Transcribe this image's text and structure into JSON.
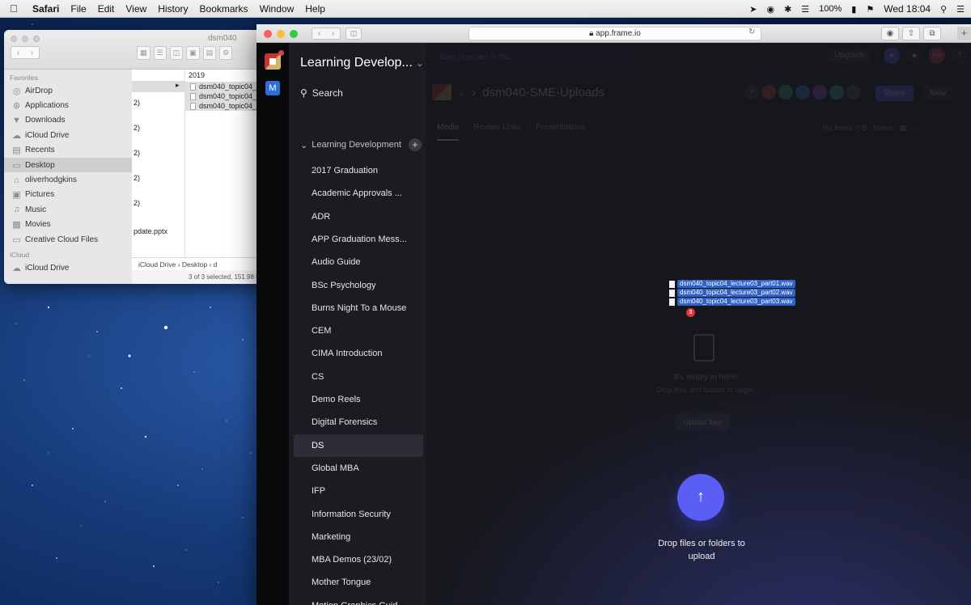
{
  "menubar": {
    "apple": "",
    "items": [
      "Safari",
      "File",
      "Edit",
      "View",
      "History",
      "Bookmarks",
      "Window",
      "Help"
    ],
    "battery": "100%",
    "clock": "Wed 18:04"
  },
  "finder": {
    "title": "dsm040",
    "favorites_header": "Favorites",
    "icloud_header": "iCloud",
    "sidebar": [
      {
        "label": "AirDrop",
        "icon": "airdrop-icon"
      },
      {
        "label": "Applications",
        "icon": "applications-icon"
      },
      {
        "label": "Downloads",
        "icon": "downloads-icon"
      },
      {
        "label": "iCloud Drive",
        "icon": "cloud-icon"
      },
      {
        "label": "Recents",
        "icon": "recents-icon"
      },
      {
        "label": "Desktop",
        "icon": "desktop-icon"
      },
      {
        "label": "oliverhodgkins",
        "icon": "home-icon"
      },
      {
        "label": "Pictures",
        "icon": "pictures-icon"
      },
      {
        "label": "Music",
        "icon": "music-icon"
      },
      {
        "label": "Movies",
        "icon": "movies-icon"
      },
      {
        "label": "Creative Cloud Files",
        "icon": "folder-icon"
      }
    ],
    "icloud_item": "iCloud Drive",
    "col1_values": [
      "2)",
      "2)",
      "2)",
      "2)",
      "2)",
      "pdate.pptx"
    ],
    "col2_header": "2019",
    "col2_files": [
      "dsm040_topic04_",
      "dsm040_topic04_",
      "dsm040_topic04_"
    ],
    "path": [
      "iCloud Drive",
      "Desktop",
      "d"
    ],
    "status": "3 of 3 selected, 151.98 G"
  },
  "safari": {
    "url": "app.frame.io"
  },
  "frameio": {
    "rail_m": "M",
    "workspace": "Learning Develop...",
    "search": "Search",
    "section": "Learning Development",
    "projects": [
      "2017 Graduation",
      "Academic Approvals ...",
      "ADR",
      "APP Graduation Mess...",
      "Audio Guide",
      "BSc Psychology",
      "Burns Night To a Mouse",
      "CEM",
      "CIMA Introduction",
      "CS",
      "Demo Reels",
      "Digital Forensics",
      "DS",
      "Global MBA",
      "IFP",
      "Information Security",
      "Marketing",
      "MBA Demos (23/02)",
      "Mother Tongue",
      "Motion Graphics Guid..."
    ],
    "active_project": "DS",
    "jump_placeholder": "Jump to project or file...",
    "upgrade": "Upgrade",
    "avatar_initials": "HS",
    "help": "?",
    "folder_name": "dsm040-SME-Uploads",
    "share": "Share",
    "new": "New",
    "tabs": [
      "Media",
      "Review Links",
      "Presentations"
    ],
    "items_count": "No Items, 0 B",
    "sort": "Name",
    "empty_title": "It's empty in here!",
    "empty_sub": "Drop files and folders to begin.",
    "upload_files": "Upload files",
    "drag_files": [
      "dsm040_topic04_lecture03_part01.wav",
      "dsm040_topic04_lecture03_part02.wav",
      "dsm040_topic04_lecture03_part03.wav"
    ],
    "drag_count": "3",
    "drop_label_1": "Drop files or folders to",
    "drop_label_2": "upload",
    "colors": {
      "accent": "#5a5ef4",
      "sidebar_bg": "#1b1c22",
      "main_bg": "#16171d",
      "badge": "#e6323c"
    }
  }
}
